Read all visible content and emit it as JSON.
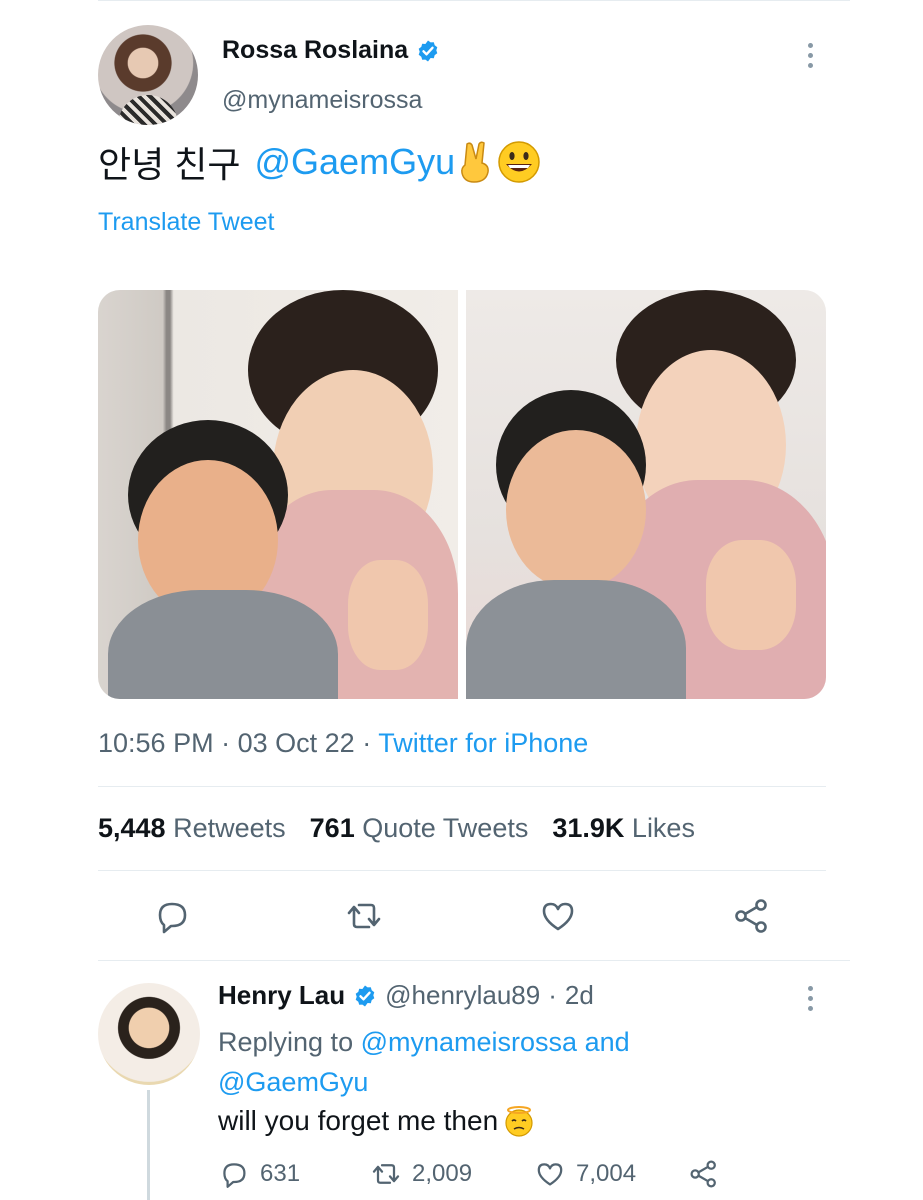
{
  "tweet": {
    "display_name": "Rossa Roslaina",
    "handle": "@mynameisrossa",
    "text_korean": "안녕 친구",
    "text_mention": "@GaemGyu",
    "emojis": [
      "victory-hand",
      "grinning-face"
    ],
    "translate_label": "Translate Tweet",
    "time": "10:56 PM",
    "date": "03 Oct 22",
    "source": "Twitter for iPhone",
    "separator": "·"
  },
  "stats": {
    "retweets_count": "5,448",
    "retweets_label": "Retweets",
    "quotes_count": "761",
    "quotes_label": "Quote Tweets",
    "likes_count": "31.9K",
    "likes_label": "Likes"
  },
  "actions": [
    "reply-icon",
    "retweet-icon",
    "like-icon",
    "share-icon"
  ],
  "reply": {
    "display_name": "Henry Lau",
    "handle": "@henrylau89",
    "age": "2d",
    "replying_prefix": "Replying to",
    "replying_to_1": "@mynameisrossa",
    "replying_and": "and",
    "replying_to_2": "@GaemGyu",
    "text": "will you forget me then",
    "emoji": "face-with-halo-worried",
    "reply_count": "631",
    "retweet_count": "2,009",
    "like_count": "7,004"
  },
  "colors": {
    "accent": "#1d9bf0",
    "secondary_text": "#536471",
    "primary_text": "#0f1419",
    "divider": "#e6ecf0"
  }
}
